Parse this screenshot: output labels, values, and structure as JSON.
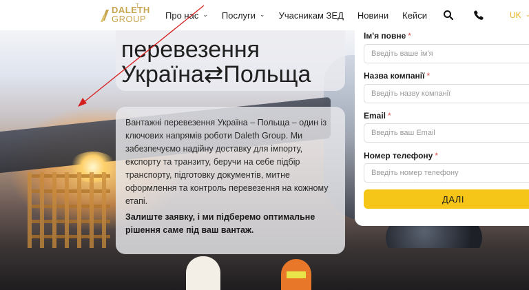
{
  "logo": {
    "line1": "DALETH",
    "line2": "GROUP",
    "mark": "T"
  },
  "nav": {
    "items": [
      {
        "label": "Про нас",
        "has_dropdown": true
      },
      {
        "label": "Послуги",
        "has_dropdown": true
      },
      {
        "label": "Учасникам ЗЕД",
        "has_dropdown": false
      },
      {
        "label": "Новини",
        "has_dropdown": false
      },
      {
        "label": "Кейси",
        "has_dropdown": false
      }
    ],
    "search_icon": "search-icon",
    "phone_icon": "phone-icon",
    "language": "UK"
  },
  "hero": {
    "title_line1": "перевезення",
    "title_line2": "Україна⇄Польща",
    "description": "Вантажні перевезення Україна – Польща – один із ключових напрямів роботи Daleth Group. Ми забезпечуємо надійну доставку для імпорту, експорту та транзиту, беручи на себе підбір транспорту, підготовку документів, митне оформлення та контроль перевезення на кожному етапі.",
    "cta_text": "Залиште заявку, і ми підберемо оптимальне рішення саме під ваш вантаж."
  },
  "form": {
    "fields": [
      {
        "label": "Ім'я повне",
        "placeholder": "Введіть ваше ім'я",
        "required": "*"
      },
      {
        "label": "Назва компанії",
        "placeholder": "Введіть назву компанії",
        "required": "*"
      },
      {
        "label": "Email",
        "placeholder": "Введіть ваш Email",
        "required": "*"
      },
      {
        "label": "Номер телефону",
        "placeholder": "Введіть номер телефону",
        "required": "*"
      }
    ],
    "submit_label": "ДАЛІ"
  },
  "colors": {
    "accent": "#f5c518",
    "logo_gold": "#c7a652",
    "required_mark": "#d84a4a",
    "annotation_arrow": "#d61f1f"
  }
}
